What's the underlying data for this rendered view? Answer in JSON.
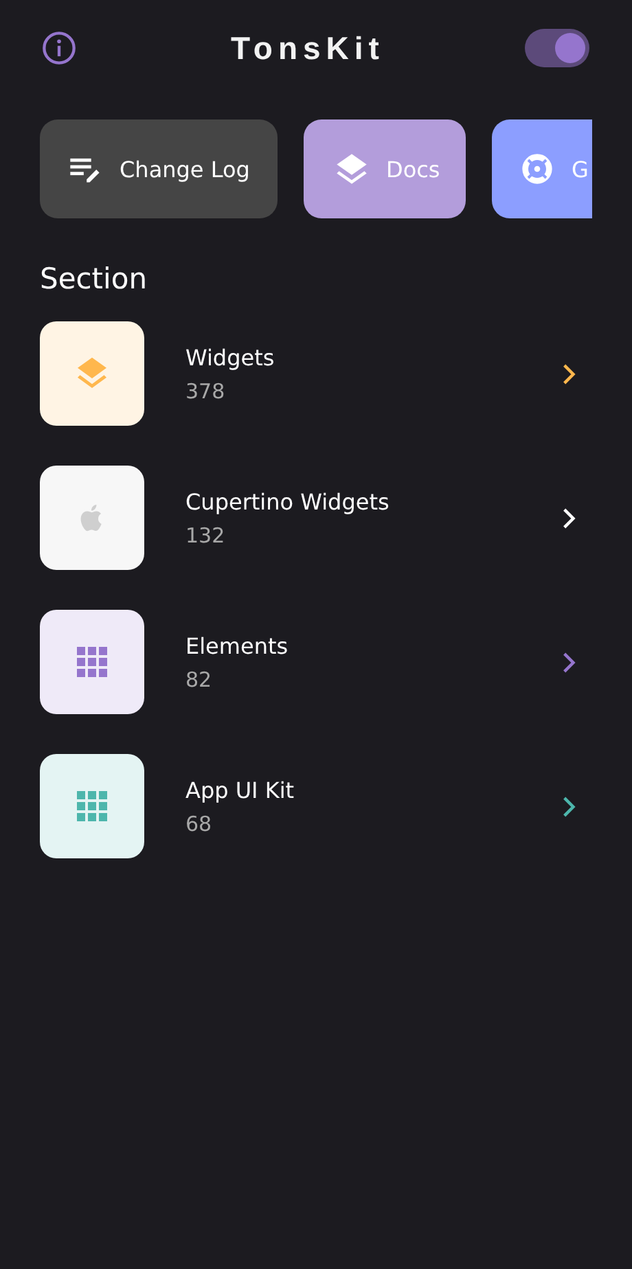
{
  "header": {
    "title": "TonsKit",
    "theme_toggle": {
      "on": true
    }
  },
  "quick_links": [
    {
      "label": "Change Log",
      "kind": "log",
      "color": "#454545"
    },
    {
      "label": "Docs",
      "kind": "layers",
      "color": "#b39ddb"
    },
    {
      "label": "G",
      "kind": "lifebuoy",
      "color": "#8c9eff"
    }
  ],
  "section": {
    "title": "Section",
    "items": [
      {
        "title": "Widgets",
        "count": "378",
        "kind": "layers",
        "color": "#ffb74d"
      },
      {
        "title": "Cupertino Widgets",
        "count": "132",
        "kind": "apple",
        "color": "#ffffff"
      },
      {
        "title": "Elements",
        "count": "82",
        "kind": "grid",
        "color": "#9575cd"
      },
      {
        "title": "App UI Kit",
        "count": "68",
        "kind": "grid",
        "color": "#4db6ac"
      }
    ]
  }
}
